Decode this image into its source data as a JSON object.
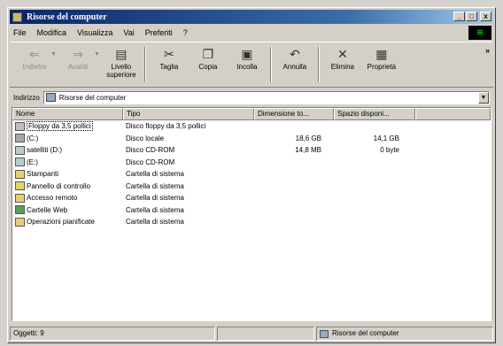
{
  "window": {
    "title": "Risorse del computer"
  },
  "window_buttons": {
    "minimize": "_",
    "maximize": "□",
    "close": "x"
  },
  "menu": [
    {
      "label": "File",
      "icon": ""
    },
    {
      "label": "Modifica"
    },
    {
      "label": "Visualizza"
    },
    {
      "label": "Vai"
    },
    {
      "label": "Preferiti"
    },
    {
      "label": "?"
    }
  ],
  "toolbar": {
    "buttons": [
      {
        "label": "Indietro",
        "icon": "back-arrow-icon",
        "disabled": true
      },
      {
        "label": "Avanti",
        "icon": "forward-arrow-icon",
        "disabled": true
      },
      {
        "label": "Livello superiore",
        "icon": "up-folder-icon",
        "disabled": false
      },
      {
        "label": "Taglia",
        "icon": "scissors-icon",
        "disabled": false
      },
      {
        "label": "Copia",
        "icon": "copy-icon",
        "disabled": false
      },
      {
        "label": "Incolla",
        "icon": "paste-icon",
        "disabled": false
      },
      {
        "label": "Annulla",
        "icon": "undo-icon",
        "disabled": false
      },
      {
        "label": "Elimina",
        "icon": "delete-x-icon",
        "disabled": false
      },
      {
        "label": "Proprietà",
        "icon": "properties-icon",
        "disabled": false
      }
    ],
    "more": "»"
  },
  "address": {
    "label": "Indirizzo",
    "value": "Risorse del computer"
  },
  "list": {
    "columns": [
      "Nome",
      "Tipo",
      "Dimensione to...",
      "Spazio disponi..."
    ],
    "rows": [
      {
        "name": "Floppy da 3,5 pollici",
        "type": "Disco floppy da 3,5 pollici",
        "size": "",
        "free": "",
        "icon": "floppy-drive-icon",
        "selected": true
      },
      {
        "name": "(C:)",
        "type": "Disco locale",
        "size": "18,6 GB",
        "free": "14,1 GB",
        "icon": "hard-drive-icon"
      },
      {
        "name": "satelliti (D:)",
        "type": "Disco CD-ROM",
        "size": "14,8 MB",
        "free": "0 byte",
        "icon": "cdrom-drive-icon"
      },
      {
        "name": "(E:)",
        "type": "Disco CD-ROM",
        "size": "",
        "free": "",
        "icon": "cdrom-drive-icon"
      },
      {
        "name": "Stampanti",
        "type": "Cartella di sistema",
        "size": "",
        "free": "",
        "icon": "printers-folder-icon"
      },
      {
        "name": "Pannello di controllo",
        "type": "Cartella di sistema",
        "size": "",
        "free": "",
        "icon": "control-panel-icon"
      },
      {
        "name": "Accesso remoto",
        "type": "Cartella di sistema",
        "size": "",
        "free": "",
        "icon": "remote-access-icon"
      },
      {
        "name": "Cartelle Web",
        "type": "Cartella di sistema",
        "size": "",
        "free": "",
        "icon": "web-folders-icon"
      },
      {
        "name": "Operazioni pianificate",
        "type": "Cartella di sistema",
        "size": "",
        "free": "",
        "icon": "scheduled-tasks-icon"
      }
    ]
  },
  "status": {
    "objects": "Oggetti: 9",
    "location": "Risorse del computer"
  },
  "colors": {
    "title_start": "#0a246a",
    "title_end": "#a6caf0",
    "face": "#d4d0c8"
  }
}
